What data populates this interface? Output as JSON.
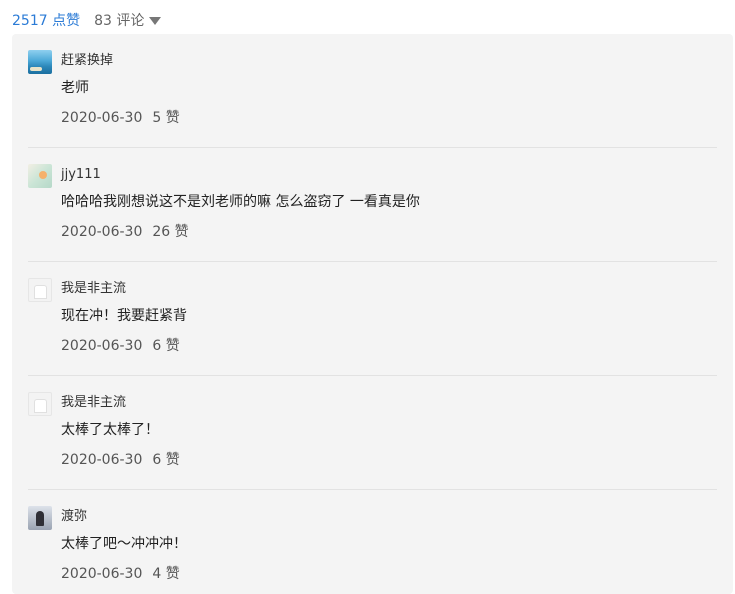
{
  "summary": {
    "likes": "2517 点赞",
    "comments": "83 评论",
    "toggle_icon": "caret-down-icon"
  },
  "comments": [
    {
      "author": "赶紧换掉",
      "text": "老师",
      "date": "2020-06-30",
      "likes": "5 赞",
      "avatar": "avatar-ocean"
    },
    {
      "author": "jjy111",
      "text": "哈哈哈我刚想说这不是刘老师的嘛 怎么盗窃了 一看真是你",
      "date": "2020-06-30",
      "likes": "26 赞",
      "avatar": "avatar-flower"
    },
    {
      "author": "我是非主流",
      "text": "现在冲！我要赶紧背",
      "date": "2020-06-30",
      "likes": "6 赞",
      "avatar": "avatar-shirt"
    },
    {
      "author": "我是非主流",
      "text": "太棒了太棒了！",
      "date": "2020-06-30",
      "likes": "6 赞",
      "avatar": "avatar-shirt"
    },
    {
      "author": "渡弥",
      "text": "太棒了吧～冲冲冲！",
      "date": "2020-06-30",
      "likes": "4 赞",
      "avatar": "avatar-person"
    }
  ],
  "colors": {
    "link": "#2b7bd6",
    "panel_background": "#f4f4f4",
    "divider": "#e2e2e2"
  }
}
